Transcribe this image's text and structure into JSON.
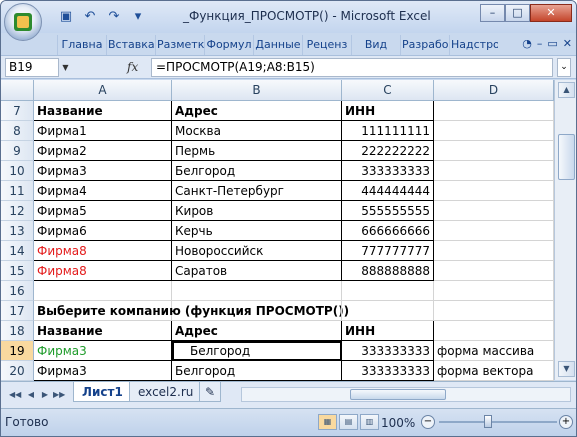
{
  "window": {
    "title": "_Функция_ПРОСМОТР() - Microsoft Excel",
    "min": "–",
    "max": "□",
    "close": "✕"
  },
  "ribbon": {
    "tabs": [
      "Главна",
      "Вставка",
      "Разметк",
      "Формул",
      "Данные",
      "Реценз",
      "Вид",
      "Разрабо",
      "Надстро"
    ]
  },
  "formula_bar": {
    "name_box": "B19",
    "fx": "fx",
    "formula": "=ПРОСМОТР(A19;A8:B15)"
  },
  "columns": [
    "A",
    "B",
    "C",
    "D"
  ],
  "rows": [
    {
      "n": "7",
      "a": "Название",
      "b": "Адрес",
      "c": "ИНН",
      "d": ""
    },
    {
      "n": "8",
      "a": "Фирма1",
      "b": "Москва",
      "c": "111111111",
      "d": ""
    },
    {
      "n": "9",
      "a": "Фирма2",
      "b": "Пермь",
      "c": "222222222",
      "d": ""
    },
    {
      "n": "10",
      "a": "Фирма3",
      "b": "Белгород",
      "c": "333333333",
      "d": ""
    },
    {
      "n": "11",
      "a": "Фирма4",
      "b": "Санкт-Петербург",
      "c": "444444444",
      "d": ""
    },
    {
      "n": "12",
      "a": "Фирма5",
      "b": "Киров",
      "c": "555555555",
      "d": ""
    },
    {
      "n": "13",
      "a": "Фирма6",
      "b": "Керчь",
      "c": "666666666",
      "d": ""
    },
    {
      "n": "14",
      "a": "Фирма8",
      "b": "Новороссийск",
      "c": "777777777",
      "d": ""
    },
    {
      "n": "15",
      "a": "Фирма8",
      "b": "Саратов",
      "c": "888888888",
      "d": ""
    },
    {
      "n": "16",
      "a": "",
      "b": "",
      "c": "",
      "d": ""
    },
    {
      "n": "17",
      "a": "Выберите компанию (функция ПРОСМОТР())",
      "b": "",
      "c": "",
      "d": ""
    },
    {
      "n": "18",
      "a": "Название",
      "b": "Адрес",
      "c": "ИНН",
      "d": ""
    },
    {
      "n": "19",
      "a": "Фирма3",
      "b": "Белгород",
      "c": "333333333",
      "d": "форма массива"
    },
    {
      "n": "20",
      "a": "Фирма3",
      "b": "Белгород",
      "c": "333333333",
      "d": "форма вектора"
    }
  ],
  "sheet_tabs": [
    "Лист1",
    "excel2.ru"
  ],
  "status": {
    "ready": "Готово",
    "zoom": "100%"
  },
  "colors": {
    "red": "#e31b1b",
    "green": "#1e9b2a",
    "selected_row_header": "#f9d99f"
  }
}
